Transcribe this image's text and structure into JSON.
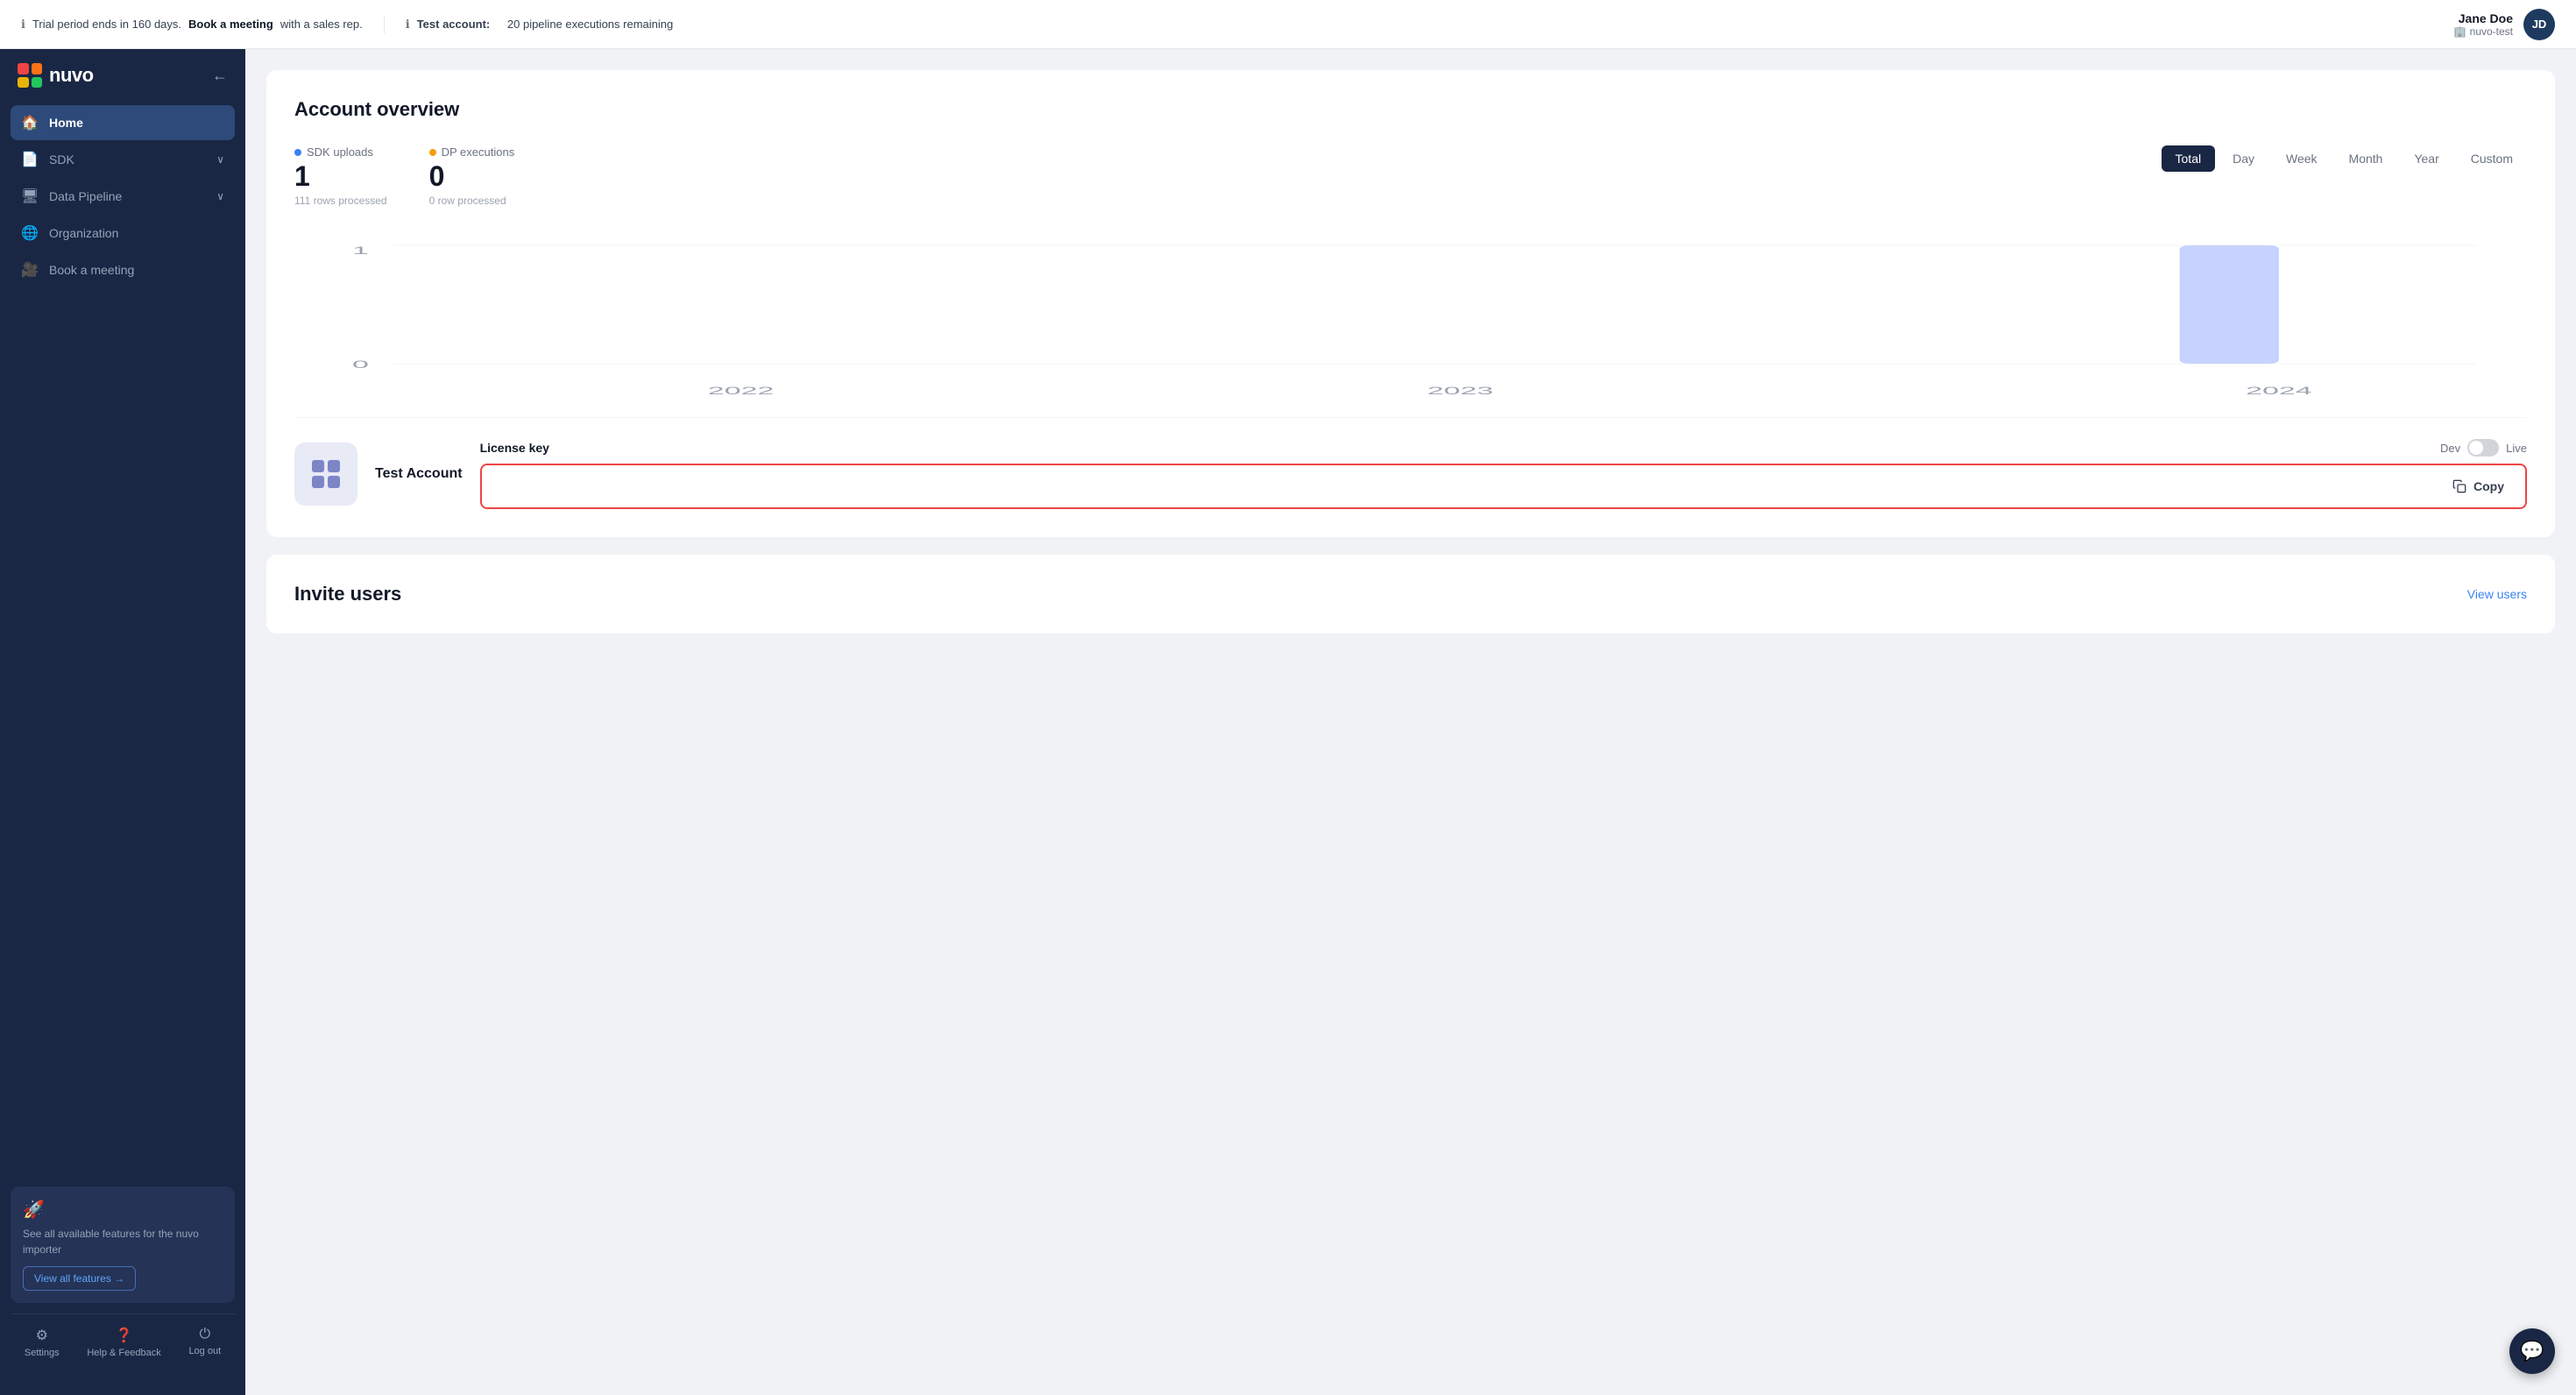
{
  "topbar": {
    "notice1_icon": "ℹ",
    "notice1_text": "Trial period ends in 160 days.",
    "notice1_link": "Book a meeting",
    "notice1_suffix": "with a sales rep.",
    "notice2_icon": "ℹ",
    "notice2_bold": "Test account:",
    "notice2_text": "20 pipeline executions remaining",
    "user_name": "Jane Doe",
    "user_org_icon": "🏢",
    "user_org": "nuvo-test",
    "avatar_initials": "JD"
  },
  "sidebar": {
    "logo_brand": "nuvo",
    "nav_items": [
      {
        "id": "home",
        "label": "Home",
        "icon": "🏠",
        "active": true
      },
      {
        "id": "sdk",
        "label": "SDK",
        "icon": "📄",
        "has_chevron": true
      },
      {
        "id": "data-pipeline",
        "label": "Data Pipeline",
        "icon": "🖥",
        "has_chevron": true
      },
      {
        "id": "organization",
        "label": "Organization",
        "icon": "🌐"
      },
      {
        "id": "book-meeting",
        "label": "Book a meeting",
        "icon": "🎥"
      }
    ],
    "promo_icon": "🚀",
    "promo_text": "See all available features for the nuvo importer",
    "promo_btn_label": "View all features →",
    "bottom_nav": [
      {
        "id": "settings",
        "label": "Settings",
        "icon": "⚙"
      },
      {
        "id": "help",
        "label": "Help & Feedback",
        "icon": "❓"
      },
      {
        "id": "logout",
        "label": "Log out",
        "icon": "⏻"
      }
    ]
  },
  "main": {
    "overview_title": "Account overview",
    "sdk_label": "SDK uploads",
    "sdk_value": "1",
    "sdk_sub": "111 rows processed",
    "dp_label": "DP executions",
    "dp_value": "0",
    "dp_sub": "0 row processed",
    "time_filters": [
      {
        "id": "total",
        "label": "Total",
        "active": true
      },
      {
        "id": "day",
        "label": "Day"
      },
      {
        "id": "week",
        "label": "Week"
      },
      {
        "id": "month",
        "label": "Month"
      },
      {
        "id": "year",
        "label": "Year"
      },
      {
        "id": "custom",
        "label": "Custom"
      }
    ],
    "chart_x_labels": [
      "2022",
      "2023",
      "2024"
    ],
    "chart_y_labels": [
      "1",
      "0"
    ],
    "license_key_label": "License key",
    "dev_label": "Dev",
    "live_label": "Live",
    "account_name": "Test Account",
    "copy_label": "Copy",
    "invite_title": "Invite users",
    "view_users_link": "View users"
  },
  "icons": {
    "copy": "⧉",
    "chevron_down": "›",
    "chat": "💬",
    "collapse": "←"
  }
}
